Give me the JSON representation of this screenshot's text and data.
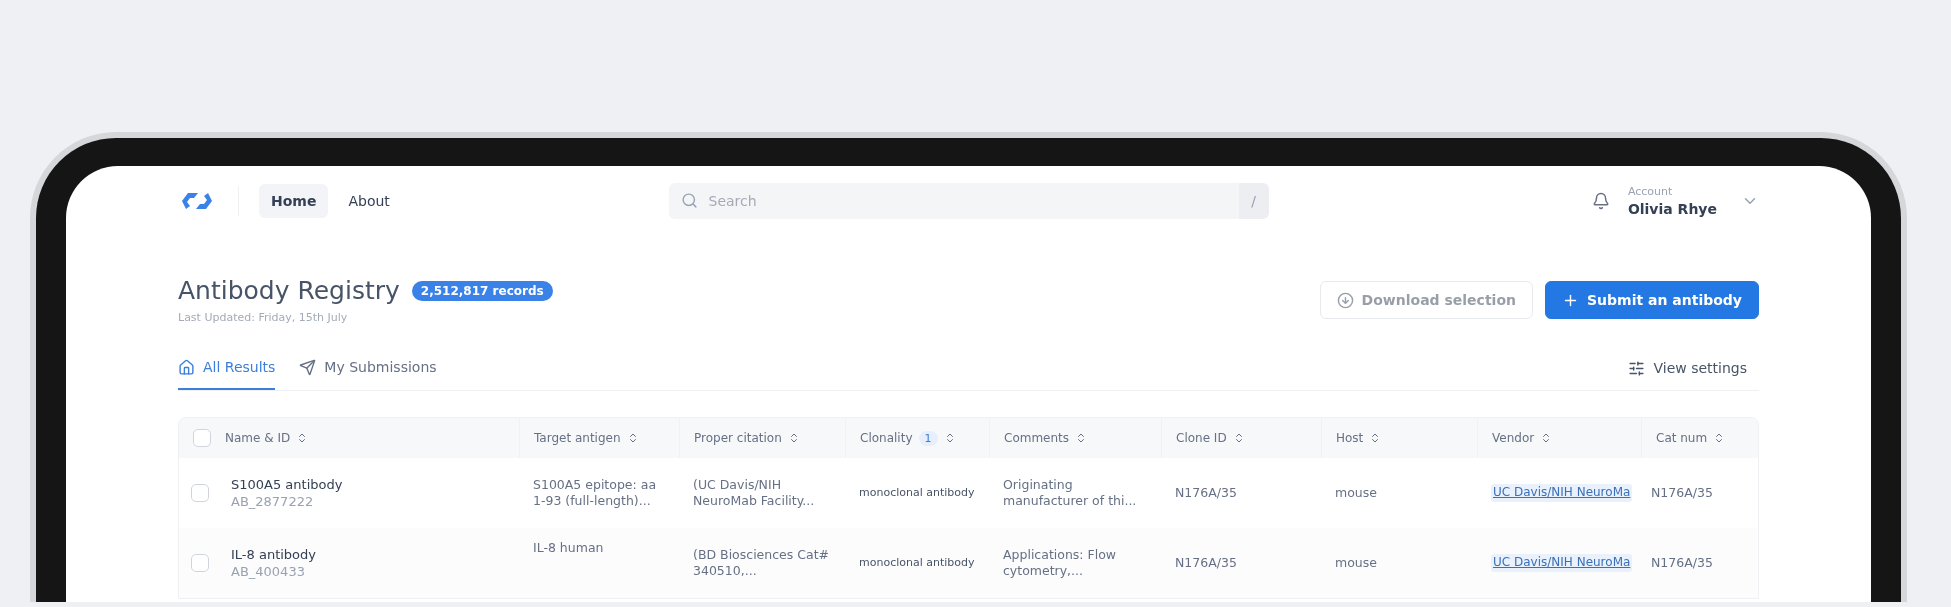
{
  "nav": {
    "items": [
      {
        "label": "Home",
        "selected": true
      },
      {
        "label": "About",
        "selected": false
      }
    ]
  },
  "search": {
    "placeholder": "Search",
    "shortcut": "/"
  },
  "account": {
    "label": "Account",
    "name": "Olivia Rhye"
  },
  "header": {
    "title": "Antibody Registry",
    "badge": "2,512,817 records",
    "subtitle": "Last Updated: Friday, 15th July"
  },
  "actions": [
    {
      "kind": "download",
      "label": "Download selection",
      "disabled": true
    },
    {
      "kind": "submit",
      "label": "Submit an antibody",
      "disabled": false
    }
  ],
  "tabs": [
    {
      "label": "All Results",
      "selected": true
    },
    {
      "label": "My Submissions",
      "selected": false
    }
  ],
  "view_settings": "View settings",
  "table": {
    "all_checked": false,
    "columns": [
      {
        "label": "Name & ID"
      },
      {
        "label": "Target antigen"
      },
      {
        "label": "Proper citation"
      },
      {
        "label": "Clonality",
        "filter_count": "1"
      },
      {
        "label": "Comments"
      },
      {
        "label": "Clone ID"
      },
      {
        "label": "Host"
      },
      {
        "label": "Vendor"
      },
      {
        "label": "Cat num"
      }
    ],
    "rows": [
      {
        "checked": false,
        "name": "S100A5 antibody",
        "id": "AB_2877222",
        "target": "S100A5 epitope: aa 1-93 (full-length)...",
        "citation": "(UC Davis/NIH NeuroMab Facility...",
        "clonality": "monoclonal antibody",
        "comments": "Originating manufacturer of thi...",
        "clone_id": "N176A/35",
        "host": "mouse",
        "vendor": "UC Davis/NIH NeuroMa",
        "cat_num": "N176A/35"
      },
      {
        "checked": false,
        "name": "IL-8 antibody",
        "id": "AB_400433",
        "target": "IL-8 human",
        "citation": "(BD Biosciences Cat# 340510,...",
        "clonality": "monoclonal antibody",
        "comments": "Applications: Flow cytometry,...",
        "clone_id": "N176A/35",
        "host": "mouse",
        "vendor": "UC Davis/NIH NeuroMa",
        "cat_num": "N176A/35"
      }
    ]
  }
}
